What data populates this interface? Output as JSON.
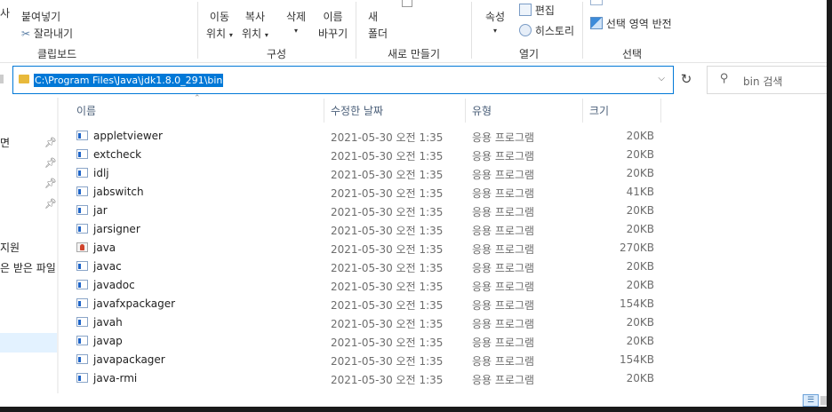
{
  "ribbon": {
    "clipboard": {
      "partial_top": "사",
      "paste_shortcut": "붙여넣기",
      "cut": "잘라내기",
      "group_label": "클립보드"
    },
    "organize": {
      "move_to_line1": "이동",
      "move_to_line2": "위치",
      "copy_to_line1": "복사",
      "copy_to_line2": "위치",
      "delete": "삭제",
      "rename_line1": "이름",
      "rename_line2": "바꾸기",
      "group_label": "구성"
    },
    "new": {
      "new_folder_line1": "새",
      "new_folder_line2": "폴더",
      "group_label": "새로 만들기"
    },
    "open": {
      "properties": "속성",
      "edit": "편집",
      "history": "히스토리",
      "group_label": "열기"
    },
    "select": {
      "invert": "선택 영역 반전",
      "group_label": "선택"
    }
  },
  "address": {
    "path": "C:\\Program Files\\Java\\jdk1.8.0_291\\bin"
  },
  "search": {
    "placeholder": "bin 검색"
  },
  "nav": {
    "items": [
      {
        "label": "면",
        "pinned": true
      },
      {
        "label": "",
        "pinned": true
      },
      {
        "label": "",
        "pinned": true
      },
      {
        "label": "",
        "pinned": true
      },
      {
        "label": "지원",
        "pinned": false
      },
      {
        "label": "은 받은 파일",
        "pinned": false
      }
    ]
  },
  "columns": {
    "name": "이름",
    "date": "수정한 날짜",
    "type": "유형",
    "size": "크기"
  },
  "files": [
    {
      "name": "appletviewer",
      "date": "2021-05-30 오전 1:35",
      "type": "응용 프로그램",
      "size": "20KB",
      "icon": "application-icon"
    },
    {
      "name": "extcheck",
      "date": "2021-05-30 오전 1:35",
      "type": "응용 프로그램",
      "size": "20KB",
      "icon": "application-icon"
    },
    {
      "name": "idlj",
      "date": "2021-05-30 오전 1:35",
      "type": "응용 프로그램",
      "size": "20KB",
      "icon": "application-icon"
    },
    {
      "name": "jabswitch",
      "date": "2021-05-30 오전 1:35",
      "type": "응용 프로그램",
      "size": "41KB",
      "icon": "application-icon"
    },
    {
      "name": "jar",
      "date": "2021-05-30 오전 1:35",
      "type": "응용 프로그램",
      "size": "20KB",
      "icon": "application-icon"
    },
    {
      "name": "jarsigner",
      "date": "2021-05-30 오전 1:35",
      "type": "응용 프로그램",
      "size": "20KB",
      "icon": "application-icon"
    },
    {
      "name": "java",
      "date": "2021-05-30 오전 1:35",
      "type": "응용 프로그램",
      "size": "270KB",
      "icon": "java-icon"
    },
    {
      "name": "javac",
      "date": "2021-05-30 오전 1:35",
      "type": "응용 프로그램",
      "size": "20KB",
      "icon": "application-icon"
    },
    {
      "name": "javadoc",
      "date": "2021-05-30 오전 1:35",
      "type": "응용 프로그램",
      "size": "20KB",
      "icon": "application-icon"
    },
    {
      "name": "javafxpackager",
      "date": "2021-05-30 오전 1:35",
      "type": "응용 프로그램",
      "size": "154KB",
      "icon": "application-icon"
    },
    {
      "name": "javah",
      "date": "2021-05-30 오전 1:35",
      "type": "응용 프로그램",
      "size": "20KB",
      "icon": "application-icon"
    },
    {
      "name": "javap",
      "date": "2021-05-30 오전 1:35",
      "type": "응용 프로그램",
      "size": "20KB",
      "icon": "application-icon"
    },
    {
      "name": "javapackager",
      "date": "2021-05-30 오전 1:35",
      "type": "응용 프로그램",
      "size": "154KB",
      "icon": "application-icon"
    },
    {
      "name": "java-rmi",
      "date": "2021-05-30 오전 1:35",
      "type": "응용 프로그램",
      "size": "20KB",
      "icon": "application-icon"
    }
  ],
  "colors": {
    "accent": "#0078d7",
    "selection": "#cce8ff",
    "header_text": "#4c607a"
  }
}
